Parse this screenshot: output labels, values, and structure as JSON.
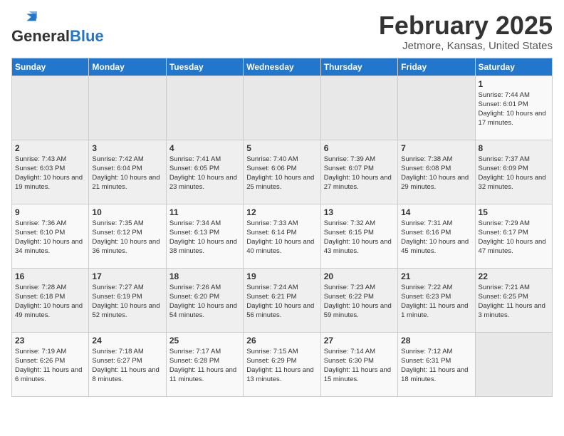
{
  "logo": {
    "line1": "General",
    "line2": "Blue"
  },
  "title": "February 2025",
  "subtitle": "Jetmore, Kansas, United States",
  "days_of_week": [
    "Sunday",
    "Monday",
    "Tuesday",
    "Wednesday",
    "Thursday",
    "Friday",
    "Saturday"
  ],
  "weeks": [
    [
      {
        "day": "",
        "info": ""
      },
      {
        "day": "",
        "info": ""
      },
      {
        "day": "",
        "info": ""
      },
      {
        "day": "",
        "info": ""
      },
      {
        "day": "",
        "info": ""
      },
      {
        "day": "",
        "info": ""
      },
      {
        "day": "1",
        "info": "Sunrise: 7:44 AM\nSunset: 6:01 PM\nDaylight: 10 hours and 17 minutes."
      }
    ],
    [
      {
        "day": "2",
        "info": "Sunrise: 7:43 AM\nSunset: 6:03 PM\nDaylight: 10 hours and 19 minutes."
      },
      {
        "day": "3",
        "info": "Sunrise: 7:42 AM\nSunset: 6:04 PM\nDaylight: 10 hours and 21 minutes."
      },
      {
        "day": "4",
        "info": "Sunrise: 7:41 AM\nSunset: 6:05 PM\nDaylight: 10 hours and 23 minutes."
      },
      {
        "day": "5",
        "info": "Sunrise: 7:40 AM\nSunset: 6:06 PM\nDaylight: 10 hours and 25 minutes."
      },
      {
        "day": "6",
        "info": "Sunrise: 7:39 AM\nSunset: 6:07 PM\nDaylight: 10 hours and 27 minutes."
      },
      {
        "day": "7",
        "info": "Sunrise: 7:38 AM\nSunset: 6:08 PM\nDaylight: 10 hours and 29 minutes."
      },
      {
        "day": "8",
        "info": "Sunrise: 7:37 AM\nSunset: 6:09 PM\nDaylight: 10 hours and 32 minutes."
      }
    ],
    [
      {
        "day": "9",
        "info": "Sunrise: 7:36 AM\nSunset: 6:10 PM\nDaylight: 10 hours and 34 minutes."
      },
      {
        "day": "10",
        "info": "Sunrise: 7:35 AM\nSunset: 6:12 PM\nDaylight: 10 hours and 36 minutes."
      },
      {
        "day": "11",
        "info": "Sunrise: 7:34 AM\nSunset: 6:13 PM\nDaylight: 10 hours and 38 minutes."
      },
      {
        "day": "12",
        "info": "Sunrise: 7:33 AM\nSunset: 6:14 PM\nDaylight: 10 hours and 40 minutes."
      },
      {
        "day": "13",
        "info": "Sunrise: 7:32 AM\nSunset: 6:15 PM\nDaylight: 10 hours and 43 minutes."
      },
      {
        "day": "14",
        "info": "Sunrise: 7:31 AM\nSunset: 6:16 PM\nDaylight: 10 hours and 45 minutes."
      },
      {
        "day": "15",
        "info": "Sunrise: 7:29 AM\nSunset: 6:17 PM\nDaylight: 10 hours and 47 minutes."
      }
    ],
    [
      {
        "day": "16",
        "info": "Sunrise: 7:28 AM\nSunset: 6:18 PM\nDaylight: 10 hours and 49 minutes."
      },
      {
        "day": "17",
        "info": "Sunrise: 7:27 AM\nSunset: 6:19 PM\nDaylight: 10 hours and 52 minutes."
      },
      {
        "day": "18",
        "info": "Sunrise: 7:26 AM\nSunset: 6:20 PM\nDaylight: 10 hours and 54 minutes."
      },
      {
        "day": "19",
        "info": "Sunrise: 7:24 AM\nSunset: 6:21 PM\nDaylight: 10 hours and 56 minutes."
      },
      {
        "day": "20",
        "info": "Sunrise: 7:23 AM\nSunset: 6:22 PM\nDaylight: 10 hours and 59 minutes."
      },
      {
        "day": "21",
        "info": "Sunrise: 7:22 AM\nSunset: 6:23 PM\nDaylight: 11 hours and 1 minute."
      },
      {
        "day": "22",
        "info": "Sunrise: 7:21 AM\nSunset: 6:25 PM\nDaylight: 11 hours and 3 minutes."
      }
    ],
    [
      {
        "day": "23",
        "info": "Sunrise: 7:19 AM\nSunset: 6:26 PM\nDaylight: 11 hours and 6 minutes."
      },
      {
        "day": "24",
        "info": "Sunrise: 7:18 AM\nSunset: 6:27 PM\nDaylight: 11 hours and 8 minutes."
      },
      {
        "day": "25",
        "info": "Sunrise: 7:17 AM\nSunset: 6:28 PM\nDaylight: 11 hours and 11 minutes."
      },
      {
        "day": "26",
        "info": "Sunrise: 7:15 AM\nSunset: 6:29 PM\nDaylight: 11 hours and 13 minutes."
      },
      {
        "day": "27",
        "info": "Sunrise: 7:14 AM\nSunset: 6:30 PM\nDaylight: 11 hours and 15 minutes."
      },
      {
        "day": "28",
        "info": "Sunrise: 7:12 AM\nSunset: 6:31 PM\nDaylight: 11 hours and 18 minutes."
      },
      {
        "day": "",
        "info": ""
      }
    ]
  ]
}
